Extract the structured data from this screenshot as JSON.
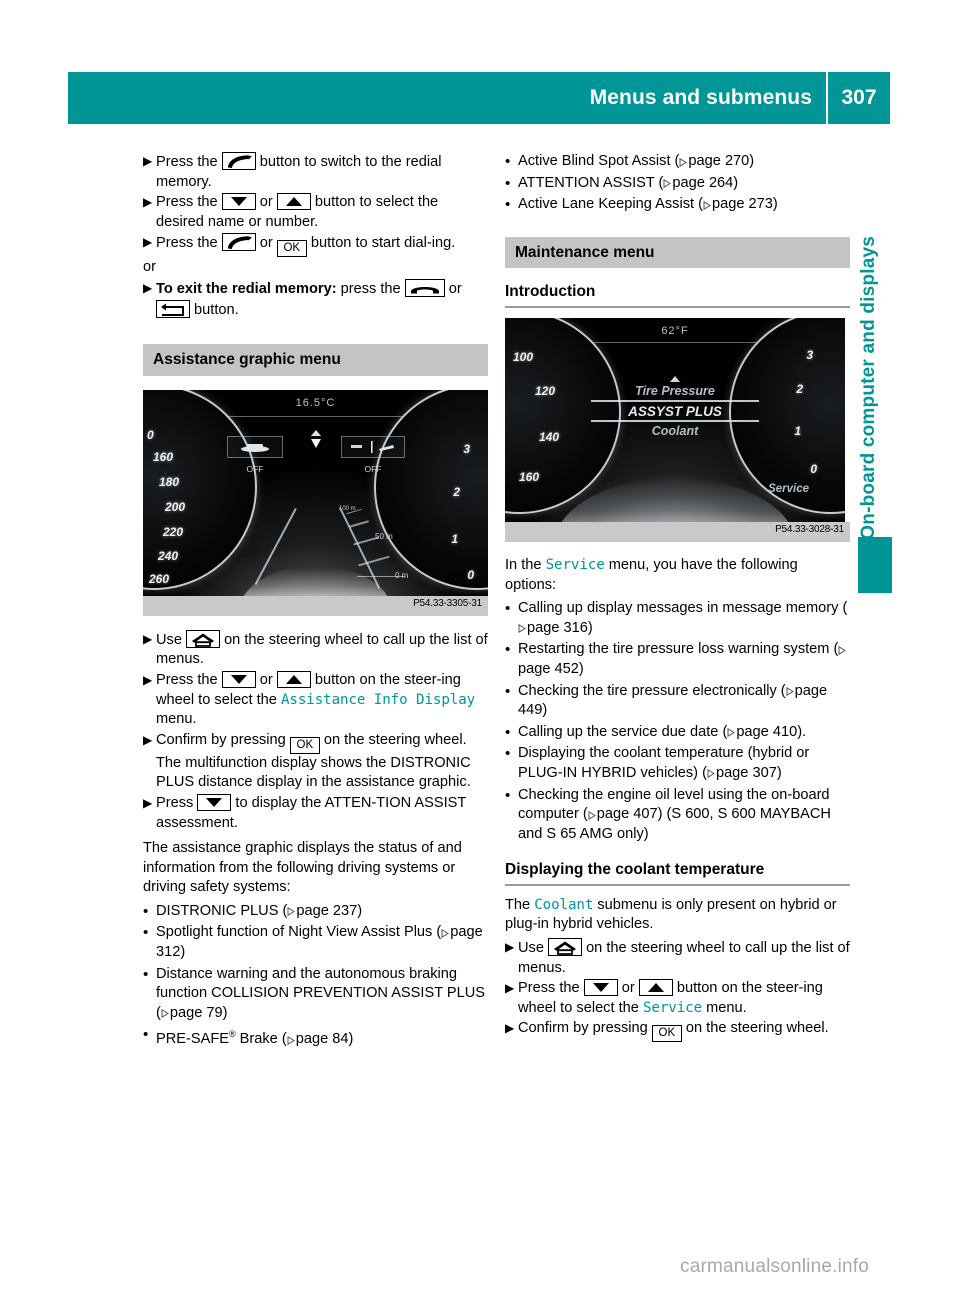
{
  "header": {
    "title": "Menus and submenus",
    "page_number": "307"
  },
  "side_tab": {
    "label": "On-board computer and displays"
  },
  "watermark": "carmanualsonline.info",
  "left_column": {
    "steps": [
      {
        "parts": [
          {
            "t": "text",
            "v": "Press the "
          },
          {
            "t": "key",
            "v": "phone-accept-icon"
          },
          {
            "t": "text",
            "v": " button to switch to the redial memory."
          }
        ]
      },
      {
        "parts": [
          {
            "t": "text",
            "v": "Press the "
          },
          {
            "t": "key",
            "v": "down-arrow-icon"
          },
          {
            "t": "text",
            "v": " or "
          },
          {
            "t": "key",
            "v": "up-arrow-icon"
          },
          {
            "t": "text",
            "v": " button to select the desired name or number."
          }
        ]
      },
      {
        "parts": [
          {
            "t": "text",
            "v": "Press the "
          },
          {
            "t": "key",
            "v": "phone-accept-icon"
          },
          {
            "t": "text",
            "v": " or "
          },
          {
            "t": "key",
            "v": "ok-icon"
          },
          {
            "t": "text",
            "v": " button to start dial‑ing."
          }
        ]
      }
    ],
    "or_text": "or",
    "exit_step": {
      "bold_lead": "To exit the redial memory:",
      "after_lead": " press the ",
      "tail": " button."
    },
    "section_bar": "Assistance graphic menu",
    "figure": {
      "code": "P54.33-3305-31",
      "temperature": "16.5°C",
      "left_dial_labels": [
        "0",
        "160",
        "180",
        "200",
        "220",
        "240",
        "260"
      ],
      "right_dial_labels": [
        "3",
        "2",
        "1",
        "0"
      ],
      "assist_left_state": "OFF",
      "assist_right_state": "OFF",
      "distance_labels": [
        "50 m",
        "0 m"
      ]
    },
    "steps2": [
      {
        "parts": [
          {
            "t": "text",
            "v": "Use "
          },
          {
            "t": "key",
            "v": "home-icon"
          },
          {
            "t": "text",
            "v": " on the steering wheel to call up the list of menus."
          }
        ]
      },
      {
        "parts": [
          {
            "t": "text",
            "v": "Press the "
          },
          {
            "t": "key",
            "v": "down-arrow-icon"
          },
          {
            "t": "text",
            "v": " or "
          },
          {
            "t": "key",
            "v": "up-arrow-icon"
          },
          {
            "t": "text",
            "v": " button on the steer-ing wheel to select the "
          },
          {
            "t": "ui",
            "v": "Assistance Info Display"
          },
          {
            "t": "text",
            "v": " menu."
          }
        ]
      },
      {
        "parts": [
          {
            "t": "text",
            "v": "Confirm by pressing "
          },
          {
            "t": "key",
            "v": "ok-icon"
          },
          {
            "t": "text",
            "v": " on the steering wheel."
          },
          {
            "t": "br"
          },
          {
            "t": "text",
            "v": "The multifunction display shows the DISTRONIC PLUS distance display in the assistance graphic."
          }
        ]
      },
      {
        "parts": [
          {
            "t": "text",
            "v": "Press "
          },
          {
            "t": "key",
            "v": "down-arrow-icon"
          },
          {
            "t": "text",
            "v": " to display the ATTEN-TION ASSIST assessment."
          }
        ]
      }
    ],
    "intro_para": "The assistance graphic displays the status of and information from the following driving systems or driving safety systems:",
    "bullets": [
      {
        "text": "DISTRONIC PLUS (",
        "ref": "page 237",
        "tail": ")"
      },
      {
        "text": "Spotlight function of Night View Assist Plus (",
        "ref": "page 312",
        "tail": ")"
      },
      {
        "text": "Distance warning and the autonomous braking function COLLISION PREVENTION ASSIST PLUS (",
        "ref": "page 79",
        "tail": ")"
      },
      {
        "text": "PRE-SAFE® Brake (",
        "ref": "page 84",
        "tail": ")"
      }
    ]
  },
  "right_column": {
    "bullets_top": [
      {
        "text": "Active Blind Spot Assist (",
        "ref": "page 270",
        "tail": ")"
      },
      {
        "text": "ATTENTION ASSIST (",
        "ref": "page 264",
        "tail": ")"
      },
      {
        "text": "Active Lane Keeping Assist (",
        "ref": "page 273",
        "tail": ")"
      }
    ],
    "section_bar": "Maintenance menu",
    "subhead_intro": "Introduction",
    "figure": {
      "code": "P54.33-3028-31",
      "temperature": "62°F",
      "left_dial_labels": [
        "100",
        "120",
        "140",
        "160"
      ],
      "right_dial_labels": [
        "3",
        "2",
        "1",
        "0"
      ],
      "menu_items": [
        "Tire Pressure",
        "ASSYST PLUS",
        "Coolant"
      ],
      "selected_item": "ASSYST PLUS",
      "footer_label": "Service"
    },
    "service_para_pre": "In the ",
    "service_para_ui": "Service",
    "service_para_post": " menu, you have the following options:",
    "bullets_service": [
      {
        "text": "Calling up display messages in message memory (",
        "ref": "page 316",
        "tail": ")"
      },
      {
        "text": "Restarting the tire pressure loss warning system (",
        "ref": "page 452",
        "tail": ")"
      },
      {
        "text": "Checking the tire pressure electronically (",
        "ref": "page 449",
        "tail": ")"
      },
      {
        "text": "Calling up the service due date (",
        "ref": "page 410",
        "tail": ")."
      },
      {
        "text": "Displaying the coolant temperature (hybrid or PLUG-IN HYBRID vehicles) (",
        "ref": "page 307",
        "tail": ")"
      },
      {
        "text": "Checking the engine oil level using the on-board computer (",
        "ref": "page 407",
        "tail": ") (S 600, S 600 MAYBACH and S 65 AMG only)"
      }
    ],
    "subhead_coolant": "Displaying the coolant temperature",
    "coolant_para_pre": "The ",
    "coolant_para_ui": "Coolant",
    "coolant_para_post": " submenu is only present on hybrid or plug-in hybrid vehicles.",
    "steps": [
      {
        "parts": [
          {
            "t": "text",
            "v": "Use "
          },
          {
            "t": "key",
            "v": "home-icon"
          },
          {
            "t": "text",
            "v": " on the steering wheel to call up the list of menus."
          }
        ]
      },
      {
        "parts": [
          {
            "t": "text",
            "v": "Press the "
          },
          {
            "t": "key",
            "v": "down-arrow-icon"
          },
          {
            "t": "text",
            "v": " or "
          },
          {
            "t": "key",
            "v": "up-arrow-icon"
          },
          {
            "t": "text",
            "v": " button on the steer-ing wheel to select the "
          },
          {
            "t": "ui",
            "v": "Service"
          },
          {
            "t": "text",
            "v": " menu."
          }
        ]
      },
      {
        "parts": [
          {
            "t": "text",
            "v": "Confirm by pressing "
          },
          {
            "t": "key",
            "v": "ok-icon"
          },
          {
            "t": "text",
            "v": " on the steering wheel."
          }
        ]
      }
    ]
  },
  "colors": {
    "teal": "#009698",
    "section_gray": "#c4c4c4",
    "rule_gray": "#9a9a9a"
  }
}
